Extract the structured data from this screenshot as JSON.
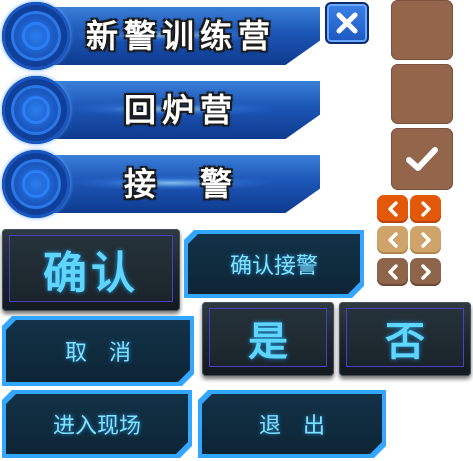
{
  "banners": [
    {
      "label": "新警训练营"
    },
    {
      "label": "回炉营"
    },
    {
      "label": "接　警"
    }
  ],
  "close_symbol": "✕",
  "dark_buttons": {
    "confirm": "确认",
    "yes": "是",
    "no": "否"
  },
  "tech_buttons": {
    "confirm_call": "确认接警",
    "cancel": "取　消",
    "enter_scene": "进入现场",
    "exit": "退　出"
  },
  "icons": {
    "checkmark": "check-icon",
    "prev": "chevron-left-icon",
    "next": "chevron-right-icon",
    "close": "close-icon"
  },
  "colors": {
    "banner_blue": "#1d56b6",
    "brown_panel": "#93664b",
    "orange": "#e4580a",
    "tan": "#cfa46a",
    "cyan_text": "#5fd6ff",
    "tech_border": "#33a7ff"
  }
}
